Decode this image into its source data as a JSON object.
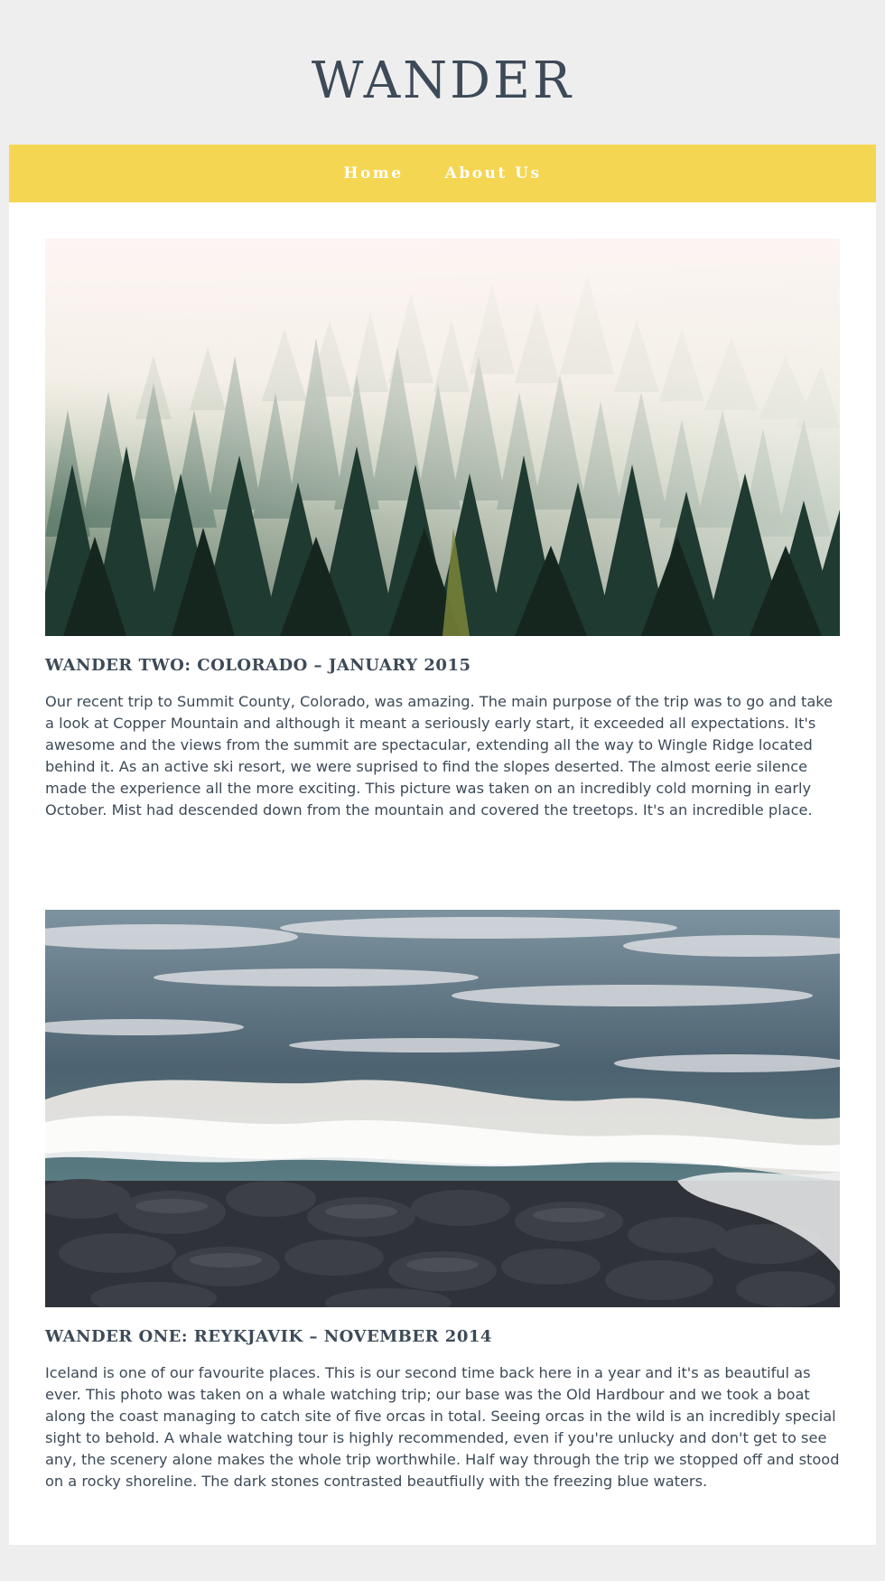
{
  "site": {
    "title": "WANDER"
  },
  "nav": {
    "items": [
      {
        "label": "Home"
      },
      {
        "label": "About Us"
      }
    ]
  },
  "colors": {
    "background": "#eeeeee",
    "nav_bar": "#f5d652",
    "text": "#3d4a58",
    "content": "#ffffff"
  },
  "posts": [
    {
      "image": "foggy-pine-forest",
      "title": "WANDER TWO: COLORADO – JANUARY 2015",
      "body": "Our recent trip to Summit County, Colorado, was amazing. The main purpose of the trip was to go and take a look at Copper Mountain and although it meant a seriously early start, it exceeded all expectations. It's awesome and the views from the summit are spectacular, extending all the way to Wingle Ridge located behind it. As an active ski resort, we were suprised to find the slopes deserted. The almost eerie silence made the experience all the more exciting. This picture was taken on an incredibly cold morning in early October. Mist had descended down from the mountain and covered the treetops. It's an incredible place."
    },
    {
      "image": "ocean-waves-rocky-shore",
      "title": "WANDER ONE: REYKJAVIK – NOVEMBER 2014",
      "body": "Iceland is one of our favourite places. This is our second time back here in a year and it's as beautiful as ever. This photo was taken on a whale watching trip; our base was the Old Hardbour and we took a boat along the coast managing to catch site of five orcas in total. Seeing orcas in the wild is an incredibly special sight to behold. A whale watching tour is highly recommended, even if you're unlucky and don't get to see any, the scenery alone makes the whole trip worthwhile. Half way through the trip we stopped off and stood on a rocky shoreline. The dark stones contrasted beautfiully with the freezing blue waters."
    }
  ]
}
